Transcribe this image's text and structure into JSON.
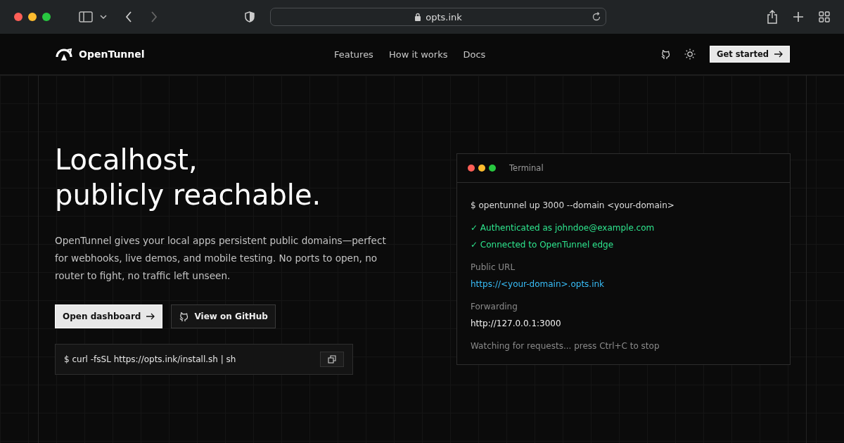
{
  "browser": {
    "url": "opts.ink"
  },
  "nav": {
    "brand": "OpenTunnel",
    "links": [
      "Features",
      "How it works",
      "Docs"
    ],
    "cta": "Get started"
  },
  "hero": {
    "title_lines": [
      "Localhost,",
      "publicly reachable."
    ],
    "description": "OpenTunnel gives your local apps persistent public domains—perfect for webhooks, live demos, and mobile testing. No ports to open, no router to fight, no traffic left unseen.",
    "primary_button": "Open dashboard",
    "secondary_button": "View on GitHub",
    "install_command": "$ curl -fsSL https://opts.ink/install.sh | sh"
  },
  "terminal": {
    "title": "Terminal",
    "lines": [
      {
        "kind": "command",
        "text": "$ opentunnel up 3000 --domain <your-domain>"
      },
      {
        "kind": "success",
        "text": "✓ Authenticated as johndoe@example.com"
      },
      {
        "kind": "success",
        "text": "✓ Connected to OpenTunnel edge"
      },
      {
        "kind": "label",
        "text": "Public URL"
      },
      {
        "kind": "link",
        "text": "https://<your-domain>.opts.ink"
      },
      {
        "kind": "label",
        "text": "Forwarding"
      },
      {
        "kind": "value",
        "text": "http://127.0.0.1:3000"
      },
      {
        "kind": "muted",
        "text": "Watching for requests... press Ctrl+C to stop"
      }
    ]
  }
}
